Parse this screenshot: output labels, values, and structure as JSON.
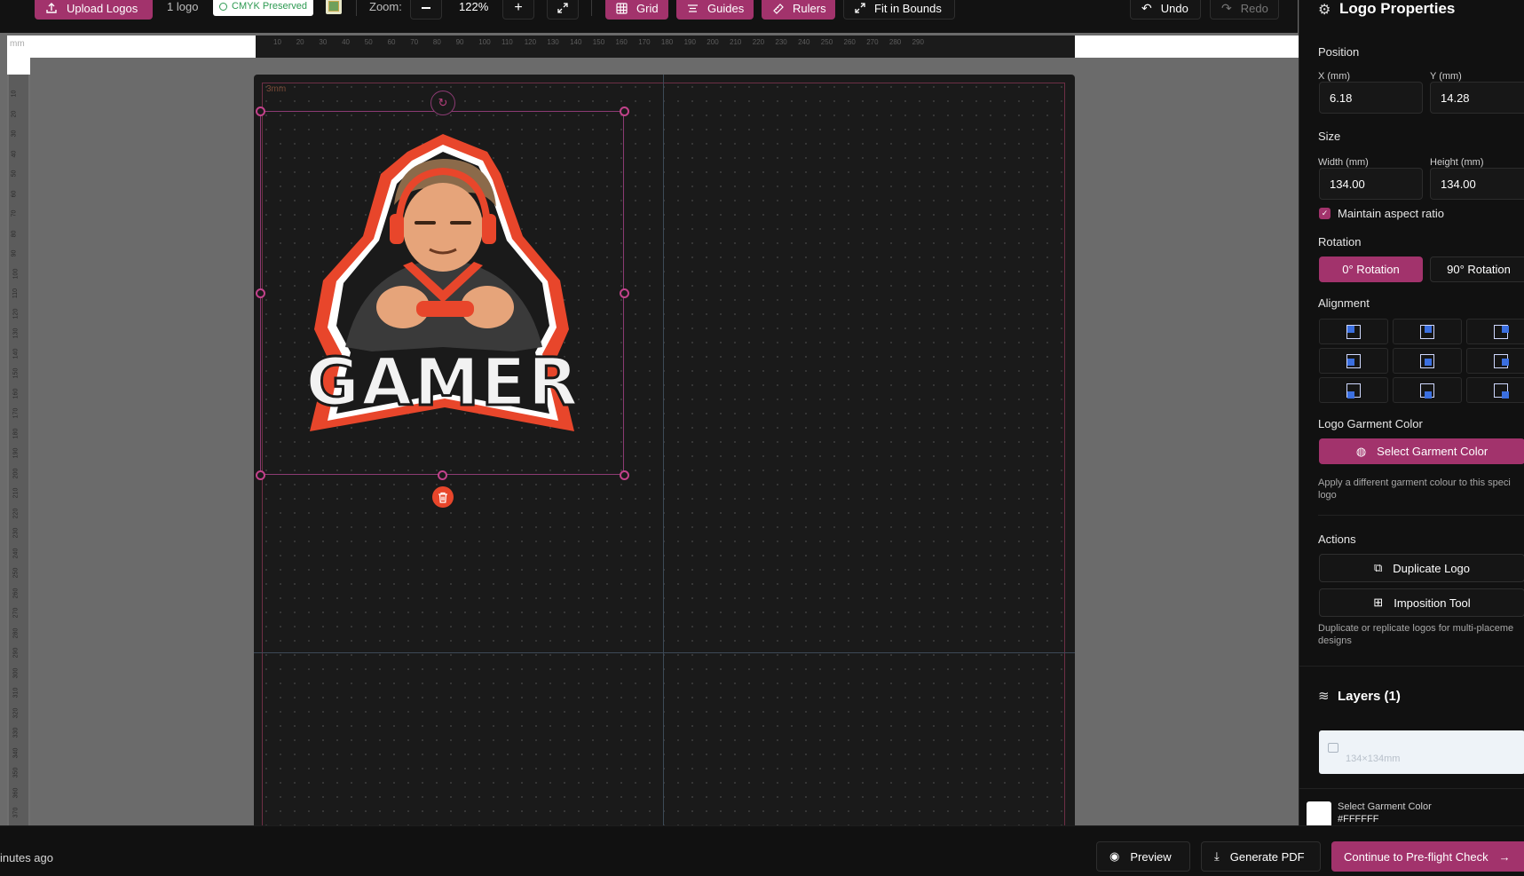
{
  "toolbar": {
    "upload_label": "Upload Logos",
    "logo_count": "1 logo",
    "cmyk_badge": "CMYK Preserved",
    "zoom_label": "Zoom:",
    "zoom_value": "122%",
    "grid_label": "Grid",
    "guides_label": "Guides",
    "rulers_label": "Rulers",
    "fit_label": "Fit in Bounds",
    "undo_label": "Undo",
    "redo_label": "Redo"
  },
  "ruler": {
    "unit": "mm",
    "h_ticks": [
      "10",
      "20",
      "30",
      "40",
      "50",
      "60",
      "70",
      "80",
      "90",
      "100",
      "110",
      "120",
      "130",
      "140",
      "150",
      "160",
      "170",
      "180",
      "190",
      "200",
      "210",
      "220",
      "230",
      "240",
      "250",
      "260",
      "270",
      "280",
      "290"
    ],
    "v_ticks": [
      "10",
      "20",
      "30",
      "40",
      "50",
      "60",
      "70",
      "80",
      "90",
      "100",
      "110",
      "120",
      "130",
      "140",
      "150",
      "160",
      "170",
      "180",
      "190",
      "200",
      "210",
      "220",
      "230",
      "240",
      "250",
      "260",
      "270",
      "280",
      "290",
      "300",
      "310",
      "320",
      "330",
      "340",
      "350",
      "360",
      "370"
    ]
  },
  "canvas": {
    "bleed_label": "3mm",
    "logo_text": "GAMER"
  },
  "panel": {
    "title": "Logo Properties",
    "position_heading": "Position",
    "x_label": "X (mm)",
    "x_value": "6.18",
    "y_label": "Y (mm)",
    "y_value": "14.28",
    "size_heading": "Size",
    "width_label": "Width (mm)",
    "width_value": "134.00",
    "height_label": "Height (mm)",
    "height_value": "134.00",
    "aspect_label": "Maintain aspect ratio",
    "aspect_checked": true,
    "rotation_heading": "Rotation",
    "rot0_label": "0° Rotation",
    "rot90_label": "90° Rotation",
    "alignment_heading": "Alignment",
    "garment_heading": "Logo Garment Color",
    "garment_button": "Select Garment Color",
    "garment_note": "Apply a different garment colour to this speci logo",
    "actions_heading": "Actions",
    "duplicate_label": "Duplicate Logo",
    "imposition_label": "Imposition Tool",
    "actions_note": "Duplicate or replicate logos for multi-placeme designs",
    "layers_heading": "Layers (1)",
    "layer_size": "134×134mm",
    "garment_color_title": "Select Garment Color",
    "garment_color_value": "#FFFFFF"
  },
  "footer": {
    "saved_text": "inutes ago",
    "preview_label": "Preview",
    "pdf_label": "Generate PDF",
    "continue_label": "Continue to Pre-flight Check"
  },
  "colors": {
    "accent": "#a2336c",
    "brand_orange": "#e8462b",
    "canvas": "#1a1a1a"
  }
}
